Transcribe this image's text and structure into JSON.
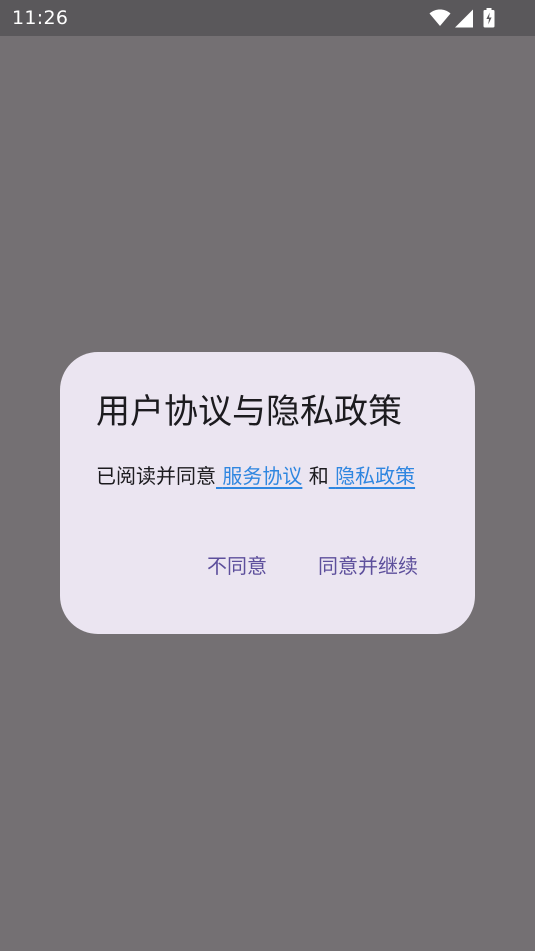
{
  "status_bar": {
    "time": "11:26",
    "icons": [
      "wifi-icon",
      "signal-icon",
      "battery-charging-icon"
    ]
  },
  "dialog": {
    "title": "用户协议与隐私政策",
    "body_prefix": "已阅读并同意",
    "link_terms": "服务协议",
    "connector": "和",
    "link_privacy": "隐私政策",
    "btn_disagree": "不同意",
    "btn_agree": "同意并继续"
  },
  "colors": {
    "scrim": "#747073",
    "status_bar": "#5a585b",
    "dialog_bg": "#ebe5f1",
    "link": "#2f86e0",
    "button_text": "#5d4f9c",
    "text": "#1c1b1f"
  }
}
